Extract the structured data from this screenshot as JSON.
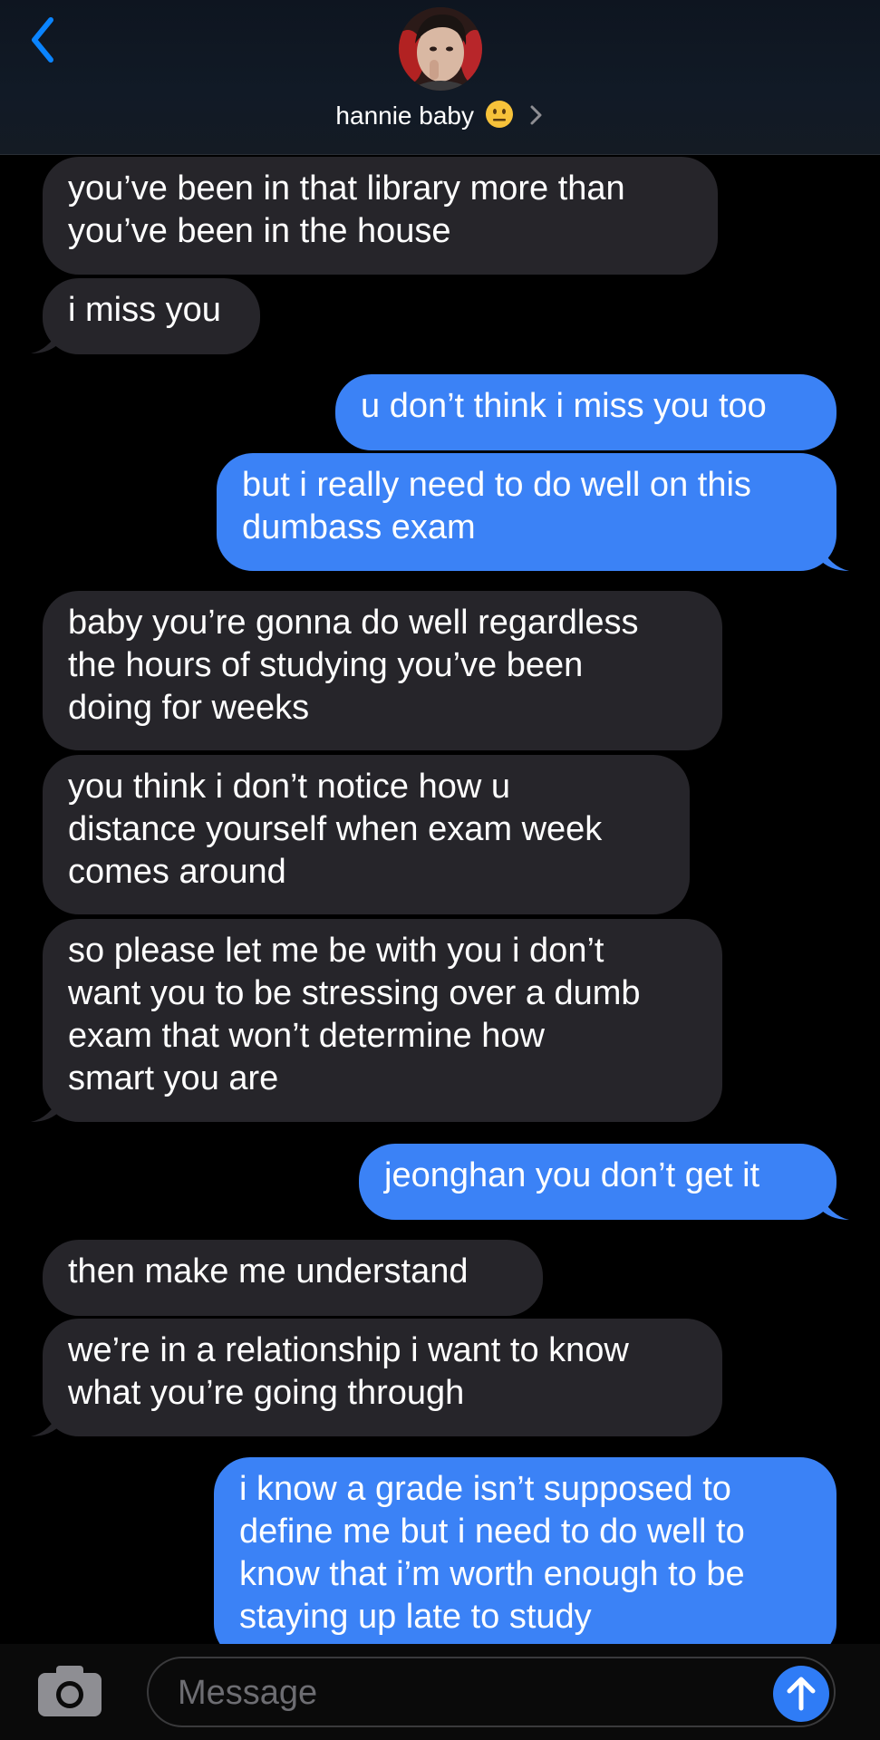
{
  "header": {
    "contact_name": "hannie baby",
    "status_emoji": "neutral-face-emoji",
    "back_icon": "chevron-left-icon",
    "disclosure_icon": "chevron-right-icon",
    "accent_color": "#0a84ff"
  },
  "messages": [
    {
      "id": "m1",
      "from": "them",
      "text": "you’ve been in that library more than\nyou’ve been in the house"
    },
    {
      "id": "m2",
      "from": "them",
      "text": "i miss you"
    },
    {
      "id": "m3",
      "from": "me",
      "text": "u don’t think i miss you too"
    },
    {
      "id": "m4",
      "from": "me",
      "text": "but i really need to do well on this\ndumbass exam"
    },
    {
      "id": "m5",
      "from": "them",
      "text": "baby you’re gonna do well regardless\nthe hours of studying you’ve been\ndoing for weeks"
    },
    {
      "id": "m6",
      "from": "them",
      "text": "you think i don’t notice how u\ndistance yourself when exam week\ncomes around"
    },
    {
      "id": "m7",
      "from": "them",
      "text": "so please let me be with you i don’t\nwant you to be stressing over a dumb\nexam that won’t determine how\nsmart you are"
    },
    {
      "id": "m8",
      "from": "me",
      "text": "jeonghan you don’t get it"
    },
    {
      "id": "m9",
      "from": "them",
      "text": "then make me understand"
    },
    {
      "id": "m10",
      "from": "them",
      "text": "we’re in a relationship i want to know\nwhat you’re going through"
    },
    {
      "id": "m11",
      "from": "me",
      "text": "i know a grade isn’t supposed to\ndefine me but i need to do well to\nknow that i’m worth enough to be\nstaying up late to study"
    }
  ],
  "composer": {
    "placeholder": "Message",
    "camera_icon": "camera-icon",
    "send_icon": "arrow-up-icon"
  },
  "colors": {
    "incoming_bubble": "#26252a",
    "outgoing_bubble": "#3b82f6",
    "background": "#000000"
  }
}
